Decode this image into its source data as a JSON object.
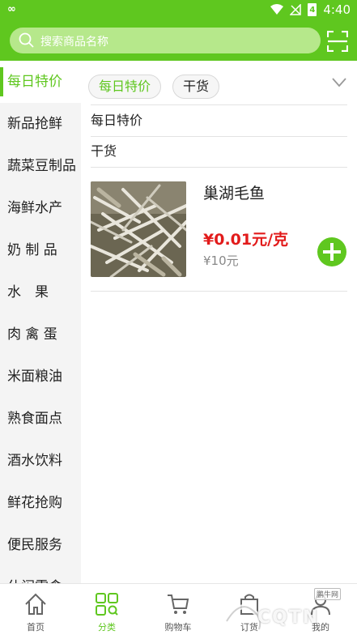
{
  "status_bar": {
    "left_icon": "∞",
    "time": "4:40",
    "battery": "4"
  },
  "search": {
    "placeholder": "搜索商品名称"
  },
  "sidebar": {
    "items": [
      "每日特价",
      "新品抢鲜",
      "蔬菜豆制品",
      "海鲜水产",
      "奶 制 品",
      "水　果",
      "肉 禽 蛋",
      "米面粮油",
      "熟食面点",
      "酒水饮料",
      "鲜花抢购",
      "便民服务",
      "休闲零食"
    ],
    "active_index": 0
  },
  "subtabs": {
    "items": [
      "每日特价",
      "干货"
    ],
    "active_index": 0
  },
  "sections": [
    "每日特价",
    "干货"
  ],
  "product": {
    "name": "巢湖毛鱼",
    "price": "¥0.01元/克",
    "original_price": "¥10元"
  },
  "tabbar": {
    "items": [
      "首页",
      "分类",
      "购物车",
      "订货",
      "我的"
    ],
    "active_index": 1
  },
  "watermark": {
    "text": "CQTN",
    "small": "鹏牛网"
  },
  "colors": {
    "accent": "#5fc71f",
    "price": "#e21b1b"
  }
}
